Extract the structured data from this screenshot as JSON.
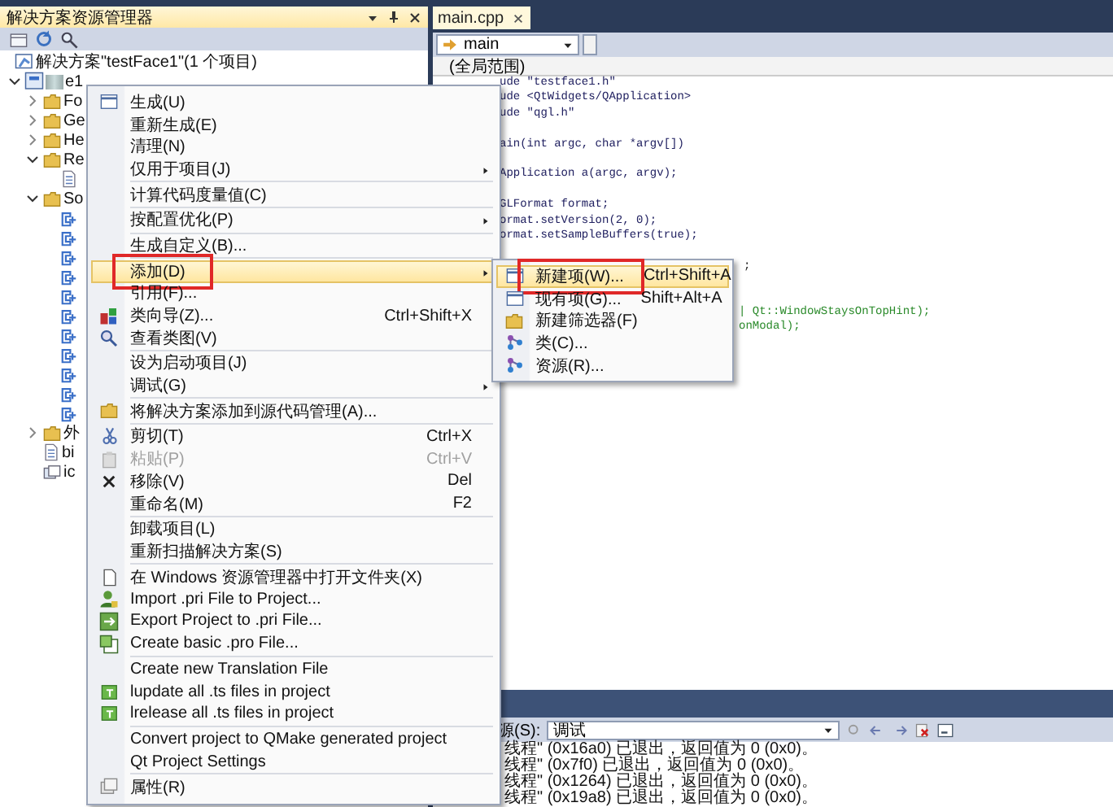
{
  "explorer": {
    "title": "解决方案资源管理器",
    "tree": [
      {
        "kind": "solution",
        "label": "解决方案\"testFace1\"(1 个项目)",
        "children": [
          {
            "kind": "project",
            "label": "e1",
            "expanded": true,
            "children": [
              {
                "kind": "folder",
                "label": "Fo",
                "expanded": false
              },
              {
                "kind": "folder",
                "label": "Ge",
                "expanded": false
              },
              {
                "kind": "folder",
                "label": "He",
                "expanded": false
              },
              {
                "kind": "folder",
                "label": "Re",
                "expanded": true,
                "children": [
                  {
                    "kind": "file"
                  }
                ]
              },
              {
                "kind": "folder",
                "label": "So",
                "expanded": true,
                "children": [
                  {
                    "kind": "source"
                  },
                  {
                    "kind": "source"
                  },
                  {
                    "kind": "source"
                  },
                  {
                    "kind": "source"
                  },
                  {
                    "kind": "source"
                  },
                  {
                    "kind": "source"
                  },
                  {
                    "kind": "source"
                  },
                  {
                    "kind": "source"
                  },
                  {
                    "kind": "source"
                  },
                  {
                    "kind": "source"
                  },
                  {
                    "kind": "source"
                  }
                ]
              },
              {
                "kind": "folder",
                "label": "外",
                "expanded": false
              },
              {
                "kind": "file",
                "label": "bi"
              },
              {
                "kind": "resource",
                "label": "ic"
              }
            ]
          }
        ]
      }
    ]
  },
  "editor": {
    "tab": {
      "label": "main.cpp",
      "selected": true
    },
    "function_combo": "main",
    "scope_item": "(全局范围)",
    "code_lines": [
      {
        "kind": "code",
        "text": "ude \"testface1.h\""
      },
      {
        "kind": "code",
        "text": "ude <QtWidgets/QApplication>"
      },
      {
        "kind": "code",
        "text": "ude \"qgl.h\""
      },
      {
        "kind": "blank"
      },
      {
        "kind": "code",
        "text": "ain(int argc, char *argv[])"
      },
      {
        "kind": "blank"
      },
      {
        "kind": "code",
        "text": "Application a(argc, argv);"
      },
      {
        "kind": "blank"
      },
      {
        "kind": "code",
        "text": "GLFormat format;"
      },
      {
        "kind": "code",
        "text": "ormat.setVersion(2, 0);"
      },
      {
        "kind": "code",
        "text": "ormat.setSampleBuffers(true);"
      },
      {
        "kind": "blank"
      },
      {
        "kind": "tail",
        "text": ";"
      },
      {
        "kind": "blank"
      },
      {
        "kind": "blank"
      },
      {
        "kind": "tail-macro",
        "text": "| Qt::WindowStaysOnTopHint);"
      },
      {
        "kind": "tail-macro",
        "text": "onModal);"
      }
    ]
  },
  "output": {
    "source_label": "源(S):",
    "source_value": "调试",
    "lines": [
      "线程\" (0x16a0) 已退出，返回值为 0 (0x0)。",
      "线程\" (0x7f0) 已退出，返回值为 0 (0x0)。",
      "线程\" (0x1264) 已退出，返回值为 0 (0x0)。",
      "线程\" (0x19a8) 已退出，返回值为 0 (0x0)。"
    ]
  },
  "context_menu": {
    "items": [
      {
        "kind": "item",
        "label": "生成(U)",
        "selected": false
      },
      {
        "kind": "item",
        "label": "重新生成(E)",
        "selected": false
      },
      {
        "kind": "item",
        "label": "清理(N)",
        "selected": false
      },
      {
        "kind": "item",
        "label": "仅用于项目(J)",
        "submenu": true,
        "selected": false
      },
      {
        "kind": "separator"
      },
      {
        "kind": "item",
        "label": "计算代码度量值(C)",
        "selected": false
      },
      {
        "kind": "separator"
      },
      {
        "kind": "item",
        "label": "按配置优化(P)",
        "submenu": true,
        "selected": false
      },
      {
        "kind": "separator"
      },
      {
        "kind": "item",
        "label": "生成自定义(B)...",
        "selected": false
      },
      {
        "kind": "separator"
      },
      {
        "kind": "item",
        "label": "添加(D)",
        "submenu": true,
        "selected": true,
        "marked": true
      },
      {
        "kind": "item",
        "label": "引用(F)...",
        "selected": false
      },
      {
        "kind": "item",
        "label": "类向导(Z)...",
        "shortcut": "Ctrl+Shift+X",
        "selected": false
      },
      {
        "kind": "item",
        "label": "查看类图(V)",
        "selected": false
      },
      {
        "kind": "separator"
      },
      {
        "kind": "item",
        "label": "设为启动项目(J)",
        "selected": false
      },
      {
        "kind": "item",
        "label": "调试(G)",
        "submenu": true,
        "selected": false
      },
      {
        "kind": "separator"
      },
      {
        "kind": "item",
        "label": "将解决方案添加到源代码管理(A)...",
        "selected": false
      },
      {
        "kind": "separator"
      },
      {
        "kind": "item",
        "label": "剪切(T)",
        "shortcut": "Ctrl+X",
        "selected": false
      },
      {
        "kind": "item",
        "label": "粘贴(P)",
        "shortcut": "Ctrl+V",
        "disabled": true,
        "selected": false
      },
      {
        "kind": "item",
        "label": "移除(V)",
        "shortcut": "Del",
        "selected": false
      },
      {
        "kind": "item",
        "label": "重命名(M)",
        "shortcut": "F2",
        "selected": false
      },
      {
        "kind": "separator"
      },
      {
        "kind": "item",
        "label": "卸载项目(L)",
        "selected": false
      },
      {
        "kind": "item",
        "label": "重新扫描解决方案(S)",
        "selected": false
      },
      {
        "kind": "separator"
      },
      {
        "kind": "item",
        "label": "在 Windows 资源管理器中打开文件夹(X)",
        "selected": false
      },
      {
        "kind": "item",
        "label": "Import .pri File to Project...",
        "selected": false
      },
      {
        "kind": "item",
        "label": "Export Project to .pri File...",
        "selected": false
      },
      {
        "kind": "item",
        "label": "Create basic .pro File...",
        "selected": false
      },
      {
        "kind": "separator"
      },
      {
        "kind": "item",
        "label": "Create new Translation File",
        "selected": false
      },
      {
        "kind": "item",
        "label": "lupdate all .ts files in project",
        "selected": false
      },
      {
        "kind": "item",
        "label": "lrelease all .ts files in project",
        "selected": false
      },
      {
        "kind": "separator"
      },
      {
        "kind": "item",
        "label": "Convert project to QMake generated project",
        "selected": false
      },
      {
        "kind": "item",
        "label": "Qt Project Settings",
        "selected": false
      },
      {
        "kind": "separator"
      },
      {
        "kind": "item",
        "label": "属性(R)",
        "selected": false
      }
    ]
  },
  "add_submenu": {
    "items": [
      {
        "kind": "item",
        "label": "新建项(W)...",
        "shortcut": "Ctrl+Shift+A",
        "selected": true,
        "marked": true
      },
      {
        "kind": "item",
        "label": "现有项(G)...",
        "shortcut": "Shift+Alt+A",
        "selected": false
      },
      {
        "kind": "item",
        "label": "新建筛选器(F)",
        "selected": false
      },
      {
        "kind": "item",
        "label": "类(C)...",
        "selected": false
      },
      {
        "kind": "item",
        "label": "资源(R)...",
        "selected": false
      }
    ]
  }
}
